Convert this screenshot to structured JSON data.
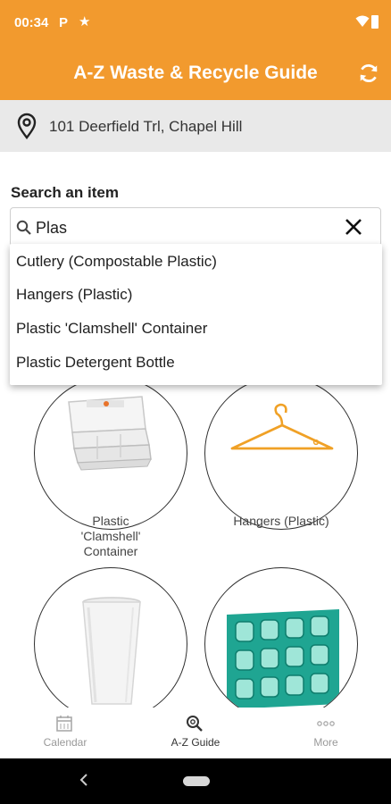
{
  "status_bar": {
    "time": "00:34",
    "p_glyph": "P",
    "star_glyph": "★"
  },
  "app_bar": {
    "title": "A-Z Waste & Recycle Guide",
    "refresh_icon": "refresh-icon"
  },
  "location": {
    "address": "101 Deerfield Trl, Chapel Hill",
    "icon": "location-pin-icon"
  },
  "search": {
    "label": "Search an item",
    "value": "Plas",
    "placeholder": ""
  },
  "suggestions": [
    "Cutlery (Compostable Plastic)",
    "Hangers (Plastic)",
    "Plastic 'Clamshell' Container",
    "Plastic Detergent Bottle"
  ],
  "grid": [
    {
      "label_lines": [
        "Plastic",
        "'Clamshell'",
        "Container"
      ],
      "image": "clamshell-container-image"
    },
    {
      "label_lines": [
        "Hangers (Plastic)"
      ],
      "image": "plastic-hanger-image"
    },
    {
      "label_lines": [],
      "image": "foam-cup-image"
    },
    {
      "label_lines": [],
      "image": "blister-pack-image"
    }
  ],
  "bottom_nav": {
    "items": [
      {
        "label": "Calendar",
        "icon": "calendar-icon",
        "active": false
      },
      {
        "label": "A-Z Guide",
        "icon": "search-guide-icon",
        "active": true
      },
      {
        "label": "More",
        "icon": "more-icon",
        "active": false
      }
    ]
  },
  "colors": {
    "primary": "#f29a2e",
    "location_bg": "#e9e9e9",
    "hanger": "#f0a126",
    "blister": "#1fa592"
  }
}
